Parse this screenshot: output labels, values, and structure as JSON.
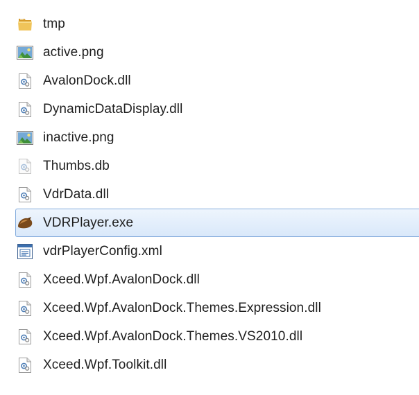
{
  "files": [
    {
      "name": "tmp",
      "icon": "folder-icon",
      "selected": false
    },
    {
      "name": "active.png",
      "icon": "image-file-icon",
      "selected": false
    },
    {
      "name": "AvalonDock.dll",
      "icon": "dll-file-icon",
      "selected": false
    },
    {
      "name": "DynamicDataDisplay.dll",
      "icon": "dll-file-icon",
      "selected": false
    },
    {
      "name": "inactive.png",
      "icon": "image-file-icon",
      "selected": false
    },
    {
      "name": "Thumbs.db",
      "icon": "db-file-icon",
      "selected": false
    },
    {
      "name": "VdrData.dll",
      "icon": "dll-file-icon",
      "selected": false
    },
    {
      "name": "VDRPlayer.exe",
      "icon": "exe-app-icon",
      "selected": true
    },
    {
      "name": "vdrPlayerConfig.xml",
      "icon": "xml-file-icon",
      "selected": false
    },
    {
      "name": "Xceed.Wpf.AvalonDock.dll",
      "icon": "dll-file-icon",
      "selected": false
    },
    {
      "name": "Xceed.Wpf.AvalonDock.Themes.Expression.dll",
      "icon": "dll-file-icon",
      "selected": false
    },
    {
      "name": "Xceed.Wpf.AvalonDock.Themes.VS2010.dll",
      "icon": "dll-file-icon",
      "selected": false
    },
    {
      "name": "Xceed.Wpf.Toolkit.dll",
      "icon": "dll-file-icon",
      "selected": false
    }
  ],
  "colors": {
    "selection_border": "#84acdd",
    "selection_fill": "#d9e8fa",
    "folder": "#e8b84a",
    "text": "#1e1e1e"
  }
}
